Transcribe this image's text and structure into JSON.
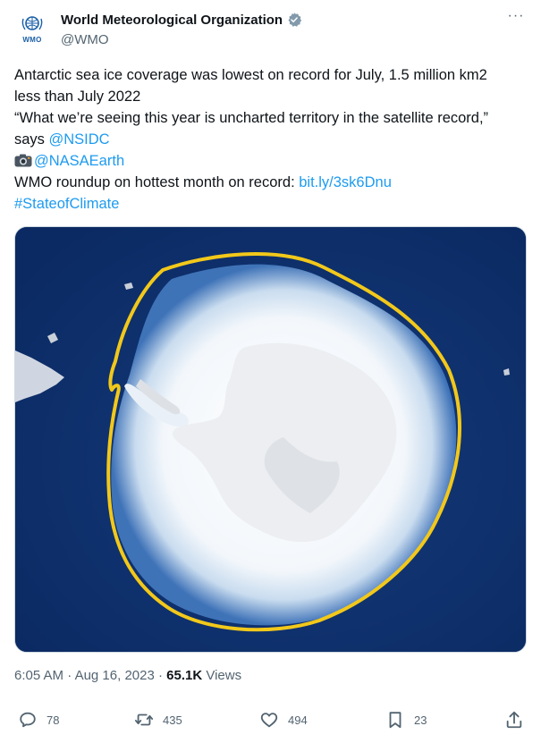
{
  "author": {
    "display_name": "World Meteorological Organization",
    "handle": "@WMO",
    "avatar_label": "WMO",
    "verified": true
  },
  "tweet": {
    "line1": "Antarctic sea ice coverage was lowest on record for July, 1.5 million km2",
    "line2": "less than July 2022",
    "line3": "“What we’re seeing this year is uncharted territory in the satellite record,”",
    "line4_prefix": "says ",
    "mention_nsidc": "@NSIDC",
    "mention_nasaearth": "@NASAEarth",
    "line6_prefix": "WMO roundup on hottest month on record: ",
    "link": "bit.ly/3sk6Dnu",
    "hashtag": "#StateofClimate"
  },
  "meta": {
    "time": "6:05 AM",
    "separator": "·",
    "date": "Aug 16, 2023",
    "views_count": "65.1K",
    "views_label": "Views"
  },
  "actions": {
    "replies": "78",
    "reposts": "435",
    "likes": "494",
    "bookmarks": "23"
  },
  "colors": {
    "link": "#1d9bf0",
    "ocean": "#0d2e6b",
    "outline": "#f2c81a",
    "secondary_text": "#536471"
  },
  "icons": {
    "more": "more-icon",
    "reply": "reply-icon",
    "repost": "repost-icon",
    "like": "heart-icon",
    "bookmark": "bookmark-icon",
    "share": "share-icon",
    "camera": "camera-icon",
    "verified": "verified-badge-icon"
  }
}
